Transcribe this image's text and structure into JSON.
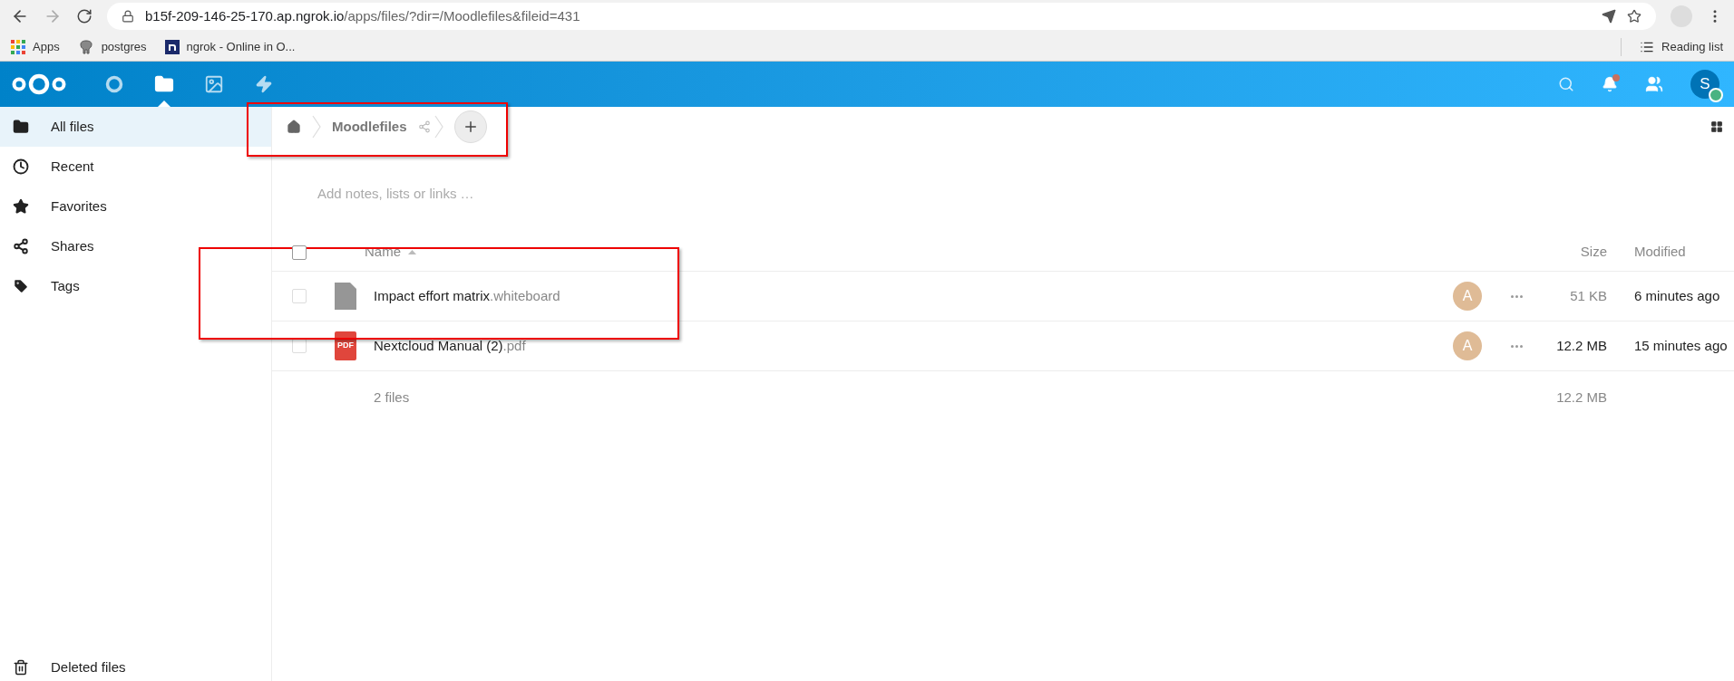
{
  "browser": {
    "url_host": "b15f-209-146-25-170.ap.ngrok.io",
    "url_path": "/apps/files/?dir=/Moodlefiles&fileid=431",
    "bookmarks": [
      {
        "label": "Apps",
        "kind": "apps"
      },
      {
        "label": "postgres",
        "kind": "elephant"
      },
      {
        "label": "ngrok - Online in O...",
        "kind": "ngrok"
      }
    ],
    "reading_list": "Reading list"
  },
  "header": {
    "apps": [
      {
        "kind": "circle",
        "selected": false
      },
      {
        "kind": "folder",
        "selected": true
      },
      {
        "kind": "image",
        "selected": false
      },
      {
        "kind": "bolt",
        "selected": false
      }
    ],
    "notification_unread": true,
    "avatar_letter": "S",
    "avatar_online": true
  },
  "sidebar": {
    "items": [
      {
        "label": "All files",
        "kind": "folder",
        "selected": true
      },
      {
        "label": "Recent",
        "kind": "clock",
        "selected": false
      },
      {
        "label": "Favorites",
        "kind": "star",
        "selected": false
      },
      {
        "label": "Shares",
        "kind": "share",
        "selected": false
      },
      {
        "label": "Tags",
        "kind": "tag",
        "selected": false
      }
    ],
    "bottom_item": "Deleted files"
  },
  "breadcrumb": {
    "folder": "Moodlefiles"
  },
  "notes": {
    "placeholder": "Add notes, lists or links …"
  },
  "table": {
    "columns": [
      "Name",
      "Size",
      "Modified"
    ],
    "all_checked": false,
    "rows": [
      {
        "name": "Impact effort matrix",
        "ext": ".whiteboard",
        "kind": "file",
        "owner": "A",
        "size": "51 KB",
        "size_strong": false,
        "modified": "6 minutes ago",
        "selected": false
      },
      {
        "name": "Nextcloud Manual (2)",
        "ext": ".pdf",
        "kind": "pdf",
        "pdf_label": "PDF",
        "owner": "A",
        "size": "12.2 MB",
        "size_strong": true,
        "modified": "15 minutes ago",
        "selected": false
      }
    ],
    "footer": {
      "count": "2 files",
      "size": "12.2 MB"
    }
  }
}
